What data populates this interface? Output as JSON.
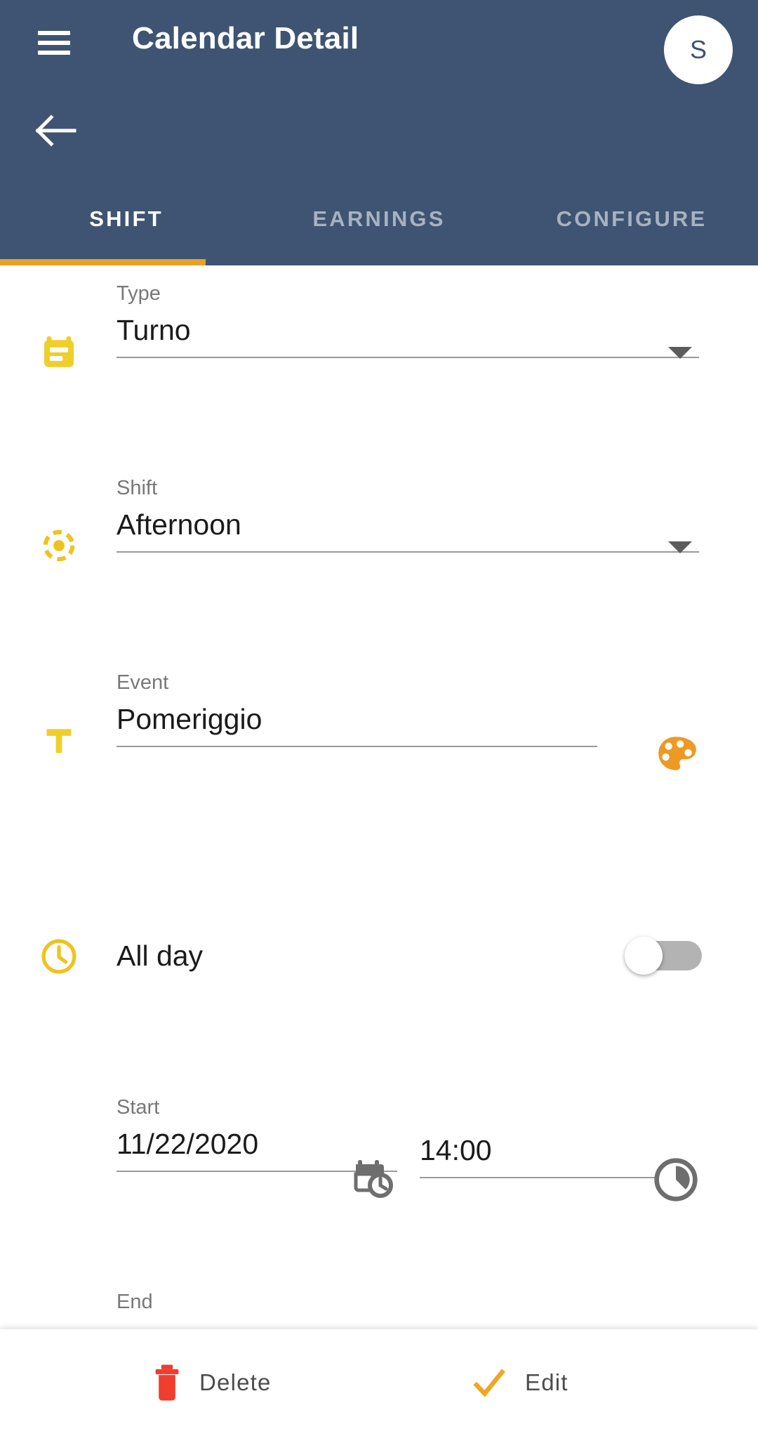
{
  "header": {
    "title": "Calendar Detail",
    "menu_icon": "hamburger-menu-icon",
    "back_icon": "back-arrow-icon",
    "avatar_initial": "S",
    "background_color": "#3e5472",
    "accent_color": "#e8a126"
  },
  "tabs": [
    {
      "label": "SHIFT",
      "active": true
    },
    {
      "label": "EARNINGS",
      "active": false
    },
    {
      "label": "CONFIGURE",
      "active": false
    }
  ],
  "form": {
    "type": {
      "label": "Type",
      "value": "Turno",
      "icon": "calendar-event-icon",
      "icon_color": "#f0ce2b"
    },
    "shift": {
      "label": "Shift",
      "value": "Afternoon",
      "icon": "sun-dashed-icon",
      "icon_color": "#eec31f"
    },
    "event": {
      "label": "Event",
      "value": "Pomeriggio",
      "icon": "text-format-icon",
      "icon_color": "#f0ce2b",
      "color_picker_icon": "palette-icon",
      "color_picker_color": "#ed9a24"
    },
    "all_day": {
      "label": "All day",
      "icon": "clock-icon",
      "icon_color": "#eec31f",
      "enabled": false
    },
    "start": {
      "label": "Start",
      "date": "11/22/2020",
      "time": "14:00",
      "date_icon": "calendar-clock-icon",
      "time_icon": "time-pie-icon",
      "icon_color": "#6e6e6e"
    },
    "end": {
      "label": "End"
    }
  },
  "bottom_bar": {
    "delete": {
      "label": "Delete",
      "icon": "trash-icon",
      "icon_color": "#ef3d2e"
    },
    "edit": {
      "label": "Edit",
      "icon": "check-icon",
      "icon_color": "#f0a623"
    }
  }
}
